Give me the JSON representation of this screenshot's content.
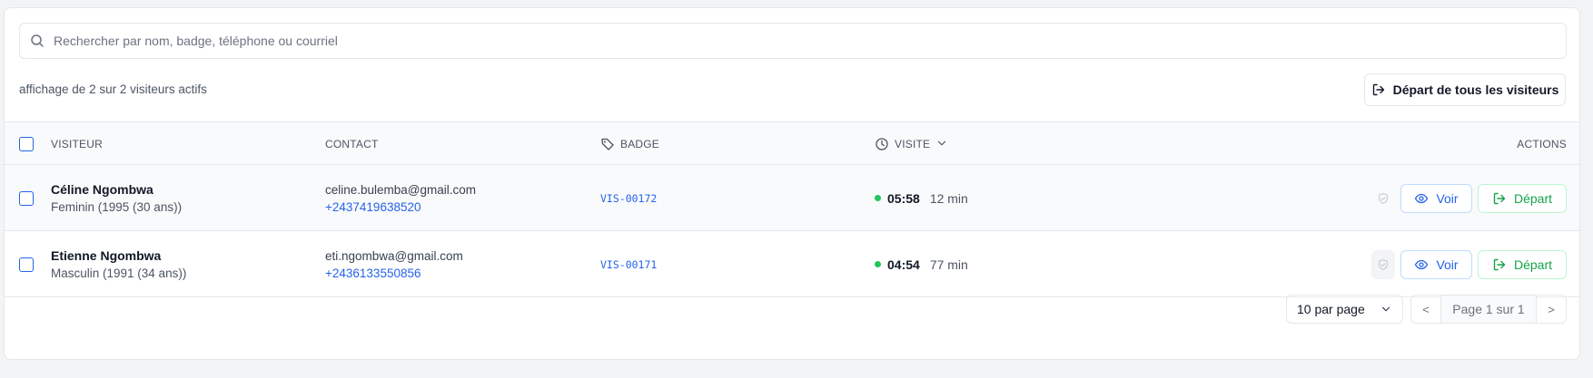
{
  "search": {
    "placeholder": "Rechercher par nom, badge, téléphone ou courriel",
    "icon": "search-icon"
  },
  "summary": {
    "count_text": "affichage de 2 sur 2 visiteurs actifs"
  },
  "toolbar": {
    "checkout_all_label": "Départ de tous les visiteurs"
  },
  "table": {
    "headers": {
      "visitor": "VISITEUR",
      "contact": "CONTACT",
      "badge": "BADGE",
      "visit": "VISITE",
      "actions": "ACTIONS"
    },
    "rows": [
      {
        "name": "Céline Ngombwa",
        "details": "Feminin (1995 (30 ans))",
        "email": "celine.bulemba@gmail.com",
        "phone": "+2437419638520",
        "badge": "VIS-00172",
        "time": "05:58",
        "duration": "12 min",
        "view_label": "Voir",
        "depart_label": "Départ"
      },
      {
        "name": "Etienne Ngombwa",
        "details": "Masculin (1991 (34 ans))",
        "email": "eti.ngombwa@gmail.com",
        "phone": "+2436133550856",
        "badge": "VIS-00171",
        "time": "04:54",
        "duration": "77 min",
        "view_label": "Voir",
        "depart_label": "Départ"
      }
    ]
  },
  "pagination": {
    "per_page": "10 par page",
    "prev": "<",
    "page_text": "Page 1 sur 1",
    "next": ">"
  },
  "colors": {
    "accent": "#2563eb",
    "success": "#16a34a",
    "status_dot": "#22c55e"
  }
}
